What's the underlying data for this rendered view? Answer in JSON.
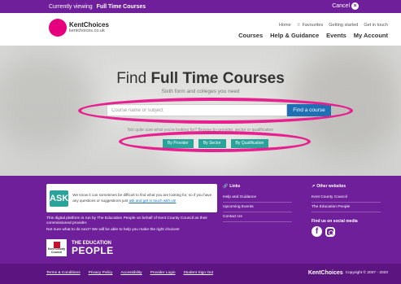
{
  "topbar": {
    "viewing_label": "Currently viewing",
    "viewing_value": "Full Time Courses",
    "cancel_label": "Cancel"
  },
  "header": {
    "brand": "KentChoices",
    "brand_url": "kentchoices.co.uk",
    "utility_links": [
      "Home",
      "Favourites",
      "Getting started",
      "Get in touch"
    ],
    "nav": [
      "Courses",
      "Help & Guidance",
      "Events",
      "My Account"
    ]
  },
  "hero": {
    "title_light": "Find",
    "title_bold": "Full Time Courses",
    "subtitle": "Sixth form and colleges you need",
    "search_placeholder": "Course name or subject",
    "search_button": "Find a course",
    "help_text": "Not quite sure what you're looking for? Browse by provider, sector or qualification",
    "browse_buttons": [
      "By Provider",
      "By Sector",
      "By Qualification"
    ]
  },
  "footer": {
    "ask_logo": "ASK",
    "ask_text": "We know it can sometimes be difficult to find what you are looking for, so if you have any questions or suggestions just",
    "ask_link": "ask and get in touch with us!",
    "platform_text": "This digital platform is run by The Education People on behalf of Kent County Council as their commissioned provider.",
    "next_text": "Not sure what to do next? We will be able to help you make the right choices!",
    "kcc_text": "Kent County Council",
    "tep_line1": "THE EDUCATION",
    "tep_line2": "PEOPLE",
    "links_heading": "Links",
    "links": [
      "Help and Guidance",
      "Upcoming Events",
      "Contact Us"
    ],
    "other_heading": "Other websites",
    "other_links": [
      "Kent County Council",
      "The Education People"
    ],
    "social_heading": "Find us on social media",
    "social_icons": [
      "facebook-icon",
      "instagram-icon"
    ]
  },
  "bottombar": {
    "links": [
      "Terms & Conditions",
      "Privacy Policy",
      "Accessibility",
      "Provider Login",
      "Student Sign Out"
    ],
    "brand": "KentChoices",
    "copyright": "Copyright © 2007 - 2020"
  },
  "colors": {
    "purple": "#6f1f9a",
    "pink": "#e6007e",
    "teal": "#2aa39a",
    "blue": "#1f6fb5",
    "annotation": "#e6218f"
  }
}
